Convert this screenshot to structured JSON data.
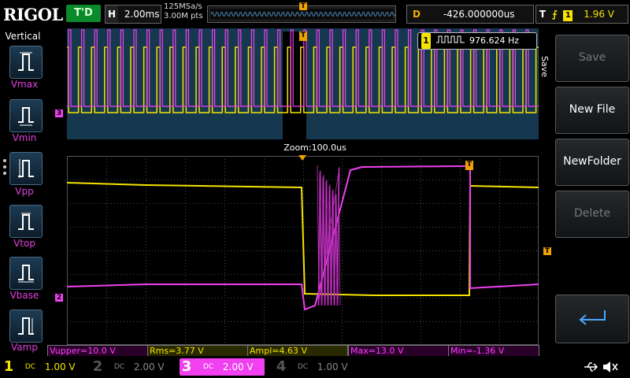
{
  "brand": "RIGOL",
  "trigger_status": "T'D",
  "horizontal": {
    "key": "H",
    "timebase": "2.00ms"
  },
  "acquisition": {
    "sample_rate": "125MSa/s",
    "memory_depth": "3.00M pts"
  },
  "delay": {
    "key": "D",
    "value": "-426.000000us"
  },
  "trigger": {
    "key": "T",
    "edge_symbol": "⨍",
    "source": "1",
    "level": "1.96 V"
  },
  "left_menu": {
    "title": "Vertical",
    "items": [
      {
        "label": "Vmax",
        "icon": "vmax-icon"
      },
      {
        "label": "Vmin",
        "icon": "vmin-icon"
      },
      {
        "label": "Vpp",
        "icon": "vpp-icon"
      },
      {
        "label": "Vtop",
        "icon": "vtop-icon"
      },
      {
        "label": "Vbase",
        "icon": "vbase-icon"
      },
      {
        "label": "Vamp",
        "icon": "vamp-icon"
      }
    ]
  },
  "right_menu": {
    "tab": "Save",
    "buttons": [
      {
        "label": "Save",
        "enabled": false
      },
      {
        "label": "New File",
        "enabled": true
      },
      {
        "label": "NewFolder",
        "enabled": true
      },
      {
        "label": "Delete",
        "enabled": false
      },
      {
        "label": "",
        "icon": "enter-icon",
        "enabled": true
      }
    ]
  },
  "frequency_counter": {
    "channel": "1",
    "value": "976.624 Hz",
    "icon": "square-wave-icon"
  },
  "zoom_label": "Zoom:100.0us",
  "markers": {
    "ch1": "1",
    "ch2": "2",
    "ch3": "3",
    "trigger": "T"
  },
  "measurements": [
    {
      "label": "Vupper=10.0 V",
      "channel": 3
    },
    {
      "label": "Rms=3.77 V",
      "channel": 1
    },
    {
      "label": "Ampl=4.63 V",
      "channel": 1
    },
    {
      "label": "Max=13.0 V",
      "channel": 3
    },
    {
      "label": "Min=-1.36 V",
      "channel": 3
    }
  ],
  "channels": [
    {
      "num": "1",
      "coupling": "DC",
      "scale": "1.00 V",
      "active": true
    },
    {
      "num": "2",
      "coupling": "DC",
      "scale": "2.00 V",
      "active": false
    },
    {
      "num": "3",
      "coupling": "DC",
      "scale": "2.00 V",
      "active": true
    },
    {
      "num": "4",
      "coupling": "DC",
      "scale": "1.00 V",
      "active": false
    }
  ],
  "status_icons": [
    "usb-icon",
    "speaker-icon"
  ],
  "colors": {
    "ch1": "#f5e400",
    "ch3": "#f040f0",
    "trigger": "#f0a000",
    "overview_bg": "#16384e"
  }
}
